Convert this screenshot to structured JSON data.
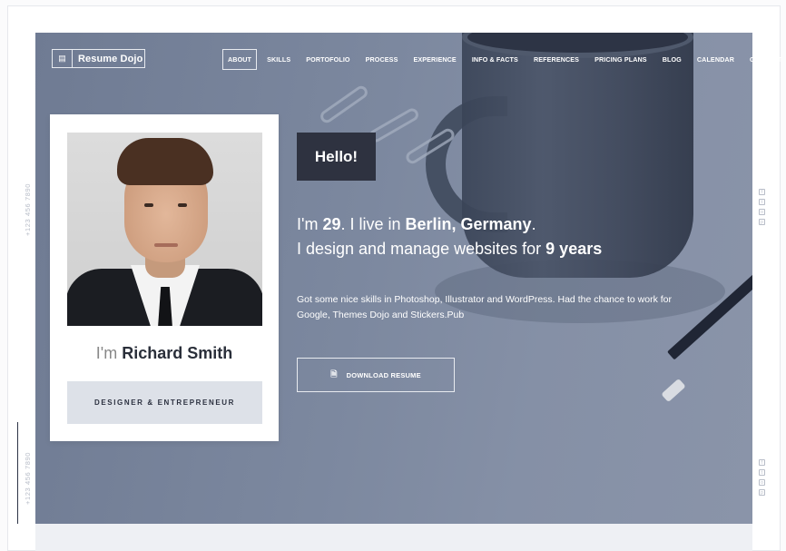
{
  "brand": {
    "logo_text": "Resume Dojo"
  },
  "nav": {
    "items": [
      {
        "label": "ABOUT",
        "active": true
      },
      {
        "label": "SKILLS"
      },
      {
        "label": "PORTOFOLIO"
      },
      {
        "label": "PROCESS"
      },
      {
        "label": "EXPERIENCE"
      },
      {
        "label": "INFO & FACTS"
      },
      {
        "label": "REFERENCES"
      },
      {
        "label": "PRICING PLANS"
      },
      {
        "label": "BLOG"
      },
      {
        "label": "CALENDAR"
      },
      {
        "label": "CONTACT"
      }
    ]
  },
  "profile": {
    "name_prefix": "I'm",
    "name": "Richard Smith",
    "role": "DESIGNER & ENTREPRENEUR"
  },
  "hero": {
    "greeting": "Hello!",
    "line1_a": "I'm ",
    "age": "29",
    "line1_b": ". I live in ",
    "location": "Berlin, Germany",
    "line1_c": ".",
    "line2_a": "I design and manage websites for ",
    "years": "9 years",
    "description": "Got some nice skills in Photoshop, Illustrator and WordPress. Had the chance to work for Google, Themes Dojo and Stickers.Pub",
    "download_label": "DOWNLOAD RESUME"
  },
  "side": {
    "phone": "+123 456 7890"
  },
  "colors": {
    "hero_bg": "#76829a",
    "card_bg": "#ffffff",
    "hello_bg": "#2e3240",
    "role_bg": "#dde1e8"
  },
  "icons": [
    "document-icon",
    "facebook-icon",
    "twitter-icon",
    "instagram-icon",
    "pinterest-icon",
    "resume-download-icon"
  ]
}
